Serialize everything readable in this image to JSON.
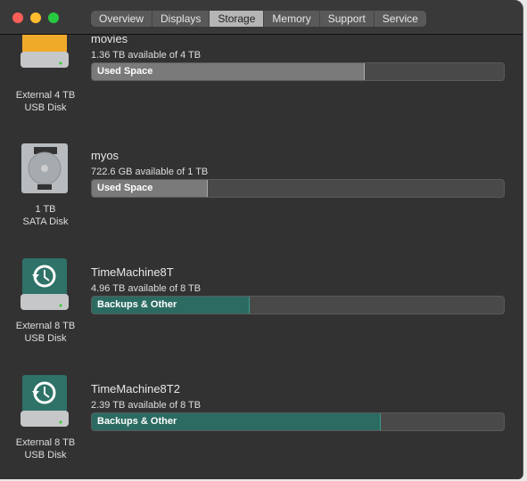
{
  "tabs": [
    "Overview",
    "Displays",
    "Storage",
    "Memory",
    "Support",
    "Service"
  ],
  "selected_tab": "Storage",
  "colors": {
    "used": "#7a7a7a",
    "backups": "#2b6b62"
  },
  "disks": [
    {
      "name": "movies",
      "available": "1.36 TB available of 4 TB",
      "bar_label": "Used Space",
      "used_fraction": 0.66,
      "kind1": "External 4 TB",
      "kind2": "USB Disk",
      "icon": "external-drive-orange-icon"
    },
    {
      "name": "myos",
      "available": "722.6 GB available of 1 TB",
      "bar_label": "Used Space",
      "used_fraction": 0.28,
      "kind1": "1 TB",
      "kind2": "SATA Disk",
      "icon": "hard-disk-icon"
    },
    {
      "name": "TimeMachine8T",
      "available": "4.96 TB available of 8 TB",
      "bar_label": "Backups & Other",
      "used_fraction": 0.38,
      "kind1": "External 8 TB",
      "kind2": "USB Disk",
      "icon": "time-machine-drive-icon"
    },
    {
      "name": "TimeMachine8T2",
      "available": "2.39 TB available of 8 TB",
      "bar_label": "Backups & Other",
      "used_fraction": 0.7,
      "kind1": "External 8 TB",
      "kind2": "USB Disk",
      "icon": "time-machine-drive-icon"
    }
  ]
}
